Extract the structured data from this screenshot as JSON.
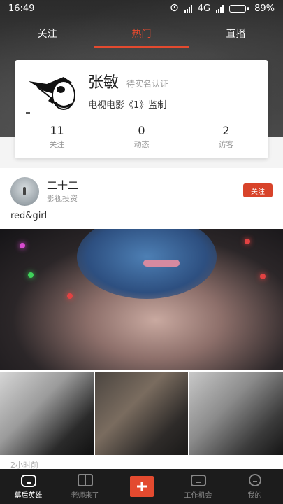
{
  "statusbar": {
    "time": "16:49",
    "network": "4G",
    "battery": "89%",
    "battery_level": 0.89
  },
  "top_tabs": [
    {
      "label": "关注",
      "active": false
    },
    {
      "label": "热门",
      "active": true
    },
    {
      "label": "直播",
      "active": false
    }
  ],
  "profile": {
    "name": "张敏",
    "verify_status": "待实名认证",
    "role": "电视电影《1》监制",
    "stats": [
      {
        "value": "11",
        "label": "关注"
      },
      {
        "value": "0",
        "label": "动态"
      },
      {
        "value": "2",
        "label": "访客"
      }
    ]
  },
  "post": {
    "user_name": "二十二",
    "user_tag": "影视投资",
    "follow_label": "关注",
    "text": "red&girl",
    "time": "2小时前"
  },
  "bottom_nav": [
    {
      "label": "幕后英雄",
      "icon": "home-icon",
      "active": true
    },
    {
      "label": "老师来了",
      "icon": "book-icon",
      "active": false
    },
    {
      "label": "",
      "icon": "plus-icon",
      "active": false
    },
    {
      "label": "工作机会",
      "icon": "briefcase-icon",
      "active": false
    },
    {
      "label": "我的",
      "icon": "profile-icon",
      "active": false
    }
  ],
  "colors": {
    "accent": "#e34a2f",
    "follow_button": "#d8432a",
    "nav_bg": "#1c1c1c"
  }
}
